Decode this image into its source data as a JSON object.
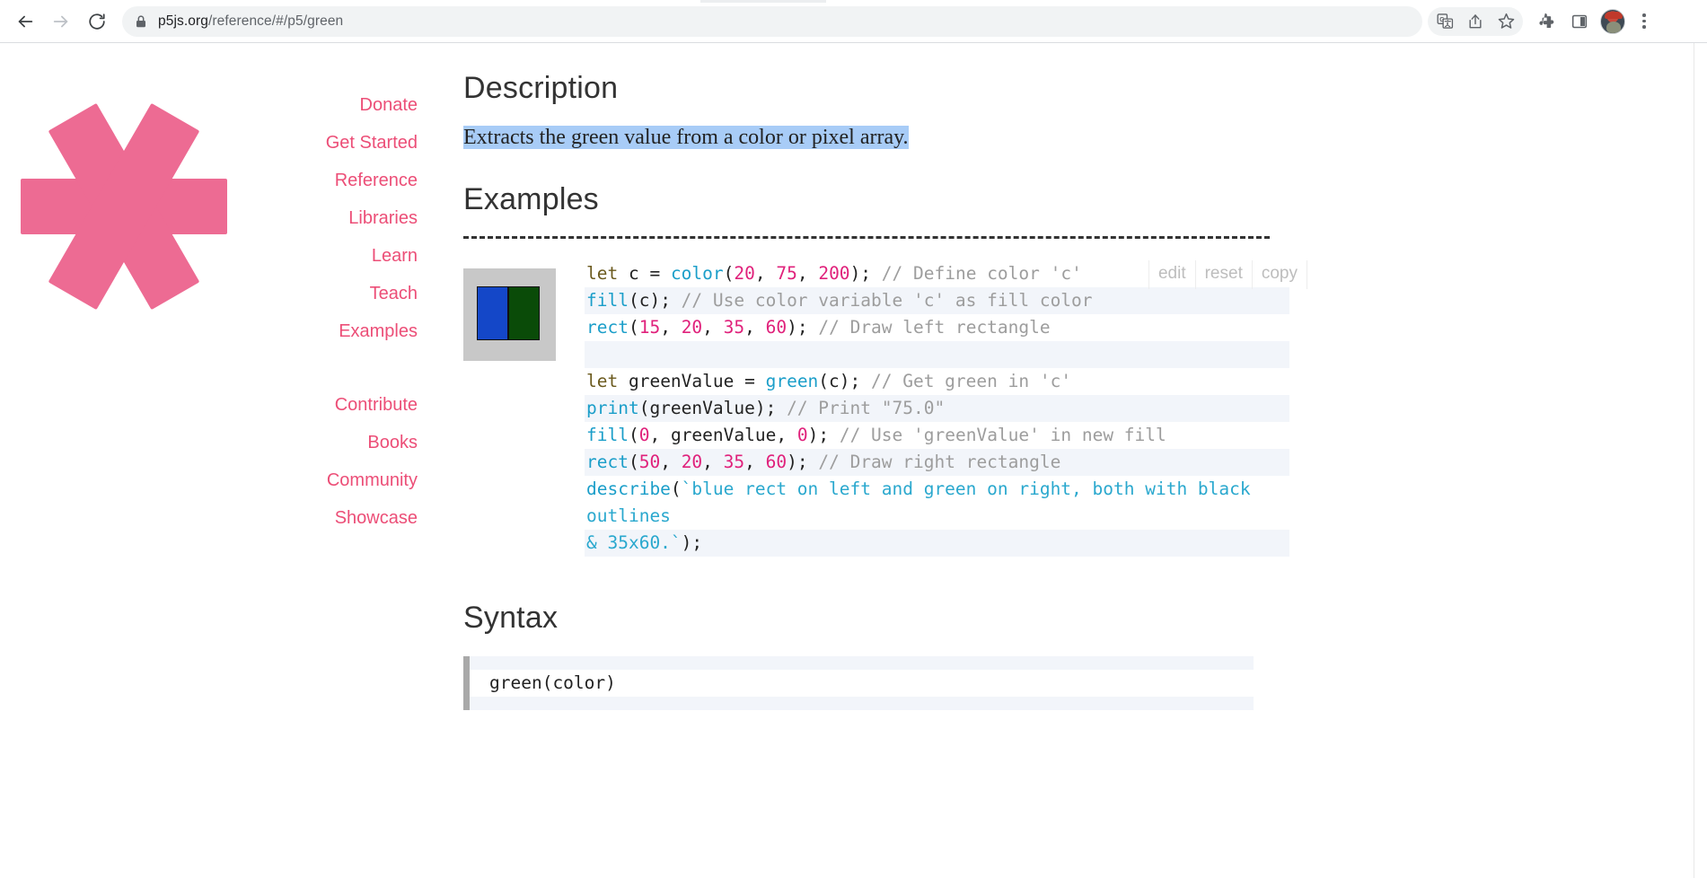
{
  "browser": {
    "back_label": "Back",
    "forward_label": "Forward",
    "reload_label": "Reload",
    "url_secure_part": "p5js.org",
    "url_path_part": "/reference/#/p5/green",
    "url_full": "p5js.org/reference/#/p5/green",
    "actions": [
      {
        "name": "translate-icon",
        "label": "Translate this page"
      },
      {
        "name": "share-icon",
        "label": "Share this page"
      },
      {
        "name": "bookmark-star-icon",
        "label": "Bookmark this tab"
      },
      {
        "name": "extensions-puzzle-icon",
        "label": "Extensions"
      },
      {
        "name": "side-panel-icon",
        "label": "Side panel"
      },
      {
        "name": "profile-avatar",
        "label": "Profile"
      },
      {
        "name": "chrome-menu-kebab-icon",
        "label": "Customize and control Google Chrome"
      }
    ]
  },
  "site": {
    "logo_name": "p5js-asterisk-logo",
    "accent_pink": "#ED6B93",
    "nav_link_color": "#EC4E77",
    "nav_primary": [
      {
        "label": "Donate"
      },
      {
        "label": "Get Started"
      },
      {
        "label": "Reference"
      },
      {
        "label": "Libraries"
      },
      {
        "label": "Learn"
      },
      {
        "label": "Teach"
      },
      {
        "label": "Examples"
      }
    ],
    "nav_secondary": [
      {
        "label": "Contribute"
      },
      {
        "label": "Books"
      },
      {
        "label": "Community"
      },
      {
        "label": "Showcase"
      }
    ]
  },
  "main": {
    "description_heading": "Description",
    "description_text": "Extracts the green value from a color or pixel array.",
    "description_highlight_color": "#A8CCF7",
    "examples_heading": "Examples",
    "syntax_heading": "Syntax",
    "code_toolbar": {
      "edit_label": "edit",
      "reset_label": "reset",
      "copy_label": "copy"
    },
    "canvas_preview": {
      "name": "sketch-canvas-preview",
      "background": "#c8c8c8",
      "left_rect_color": "#1447C8",
      "right_rect_color": "#0A4B08",
      "outline_color": "#111111"
    },
    "code_lines": [
      {
        "alt": false,
        "tokens": [
          {
            "t": "let ",
            "c": "kw"
          },
          {
            "t": "c = ",
            "c": "pl"
          },
          {
            "t": "color",
            "c": "fn"
          },
          {
            "t": "(",
            "c": "pl"
          },
          {
            "t": "20",
            "c": "num"
          },
          {
            "t": ", ",
            "c": "pl"
          },
          {
            "t": "75",
            "c": "num"
          },
          {
            "t": ", ",
            "c": "pl"
          },
          {
            "t": "200",
            "c": "num"
          },
          {
            "t": "); ",
            "c": "pl"
          },
          {
            "t": "// Define color 'c'",
            "c": "com"
          }
        ]
      },
      {
        "alt": true,
        "tokens": [
          {
            "t": "fill",
            "c": "fn"
          },
          {
            "t": "(c); ",
            "c": "pl"
          },
          {
            "t": "// Use color variable 'c' as fill color",
            "c": "com"
          }
        ]
      },
      {
        "alt": false,
        "tokens": [
          {
            "t": "rect",
            "c": "fn"
          },
          {
            "t": "(",
            "c": "pl"
          },
          {
            "t": "15",
            "c": "num"
          },
          {
            "t": ", ",
            "c": "pl"
          },
          {
            "t": "20",
            "c": "num"
          },
          {
            "t": ", ",
            "c": "pl"
          },
          {
            "t": "35",
            "c": "num"
          },
          {
            "t": ", ",
            "c": "pl"
          },
          {
            "t": "60",
            "c": "num"
          },
          {
            "t": "); ",
            "c": "pl"
          },
          {
            "t": "// Draw left rectangle",
            "c": "com"
          }
        ]
      },
      {
        "alt": true,
        "tokens": []
      },
      {
        "alt": false,
        "tokens": [
          {
            "t": "let ",
            "c": "kw"
          },
          {
            "t": "greenValue = ",
            "c": "pl"
          },
          {
            "t": "green",
            "c": "fn"
          },
          {
            "t": "(c); ",
            "c": "pl"
          },
          {
            "t": "// Get green in 'c'",
            "c": "com"
          }
        ]
      },
      {
        "alt": true,
        "tokens": [
          {
            "t": "print",
            "c": "fn"
          },
          {
            "t": "(greenValue); ",
            "c": "pl"
          },
          {
            "t": "// Print \"75.0\"",
            "c": "com"
          }
        ]
      },
      {
        "alt": false,
        "tokens": [
          {
            "t": "fill",
            "c": "fn"
          },
          {
            "t": "(",
            "c": "pl"
          },
          {
            "t": "0",
            "c": "num"
          },
          {
            "t": ", greenValue, ",
            "c": "pl"
          },
          {
            "t": "0",
            "c": "num"
          },
          {
            "t": "); ",
            "c": "pl"
          },
          {
            "t": "// Use 'greenValue' in new fill",
            "c": "com"
          }
        ]
      },
      {
        "alt": true,
        "tokens": [
          {
            "t": "rect",
            "c": "fn"
          },
          {
            "t": "(",
            "c": "pl"
          },
          {
            "t": "50",
            "c": "num"
          },
          {
            "t": ", ",
            "c": "pl"
          },
          {
            "t": "20",
            "c": "num"
          },
          {
            "t": ", ",
            "c": "pl"
          },
          {
            "t": "35",
            "c": "num"
          },
          {
            "t": ", ",
            "c": "pl"
          },
          {
            "t": "60",
            "c": "num"
          },
          {
            "t": "); ",
            "c": "pl"
          },
          {
            "t": "// Draw right rectangle",
            "c": "com"
          }
        ]
      },
      {
        "alt": false,
        "tokens": [
          {
            "t": "describe",
            "c": "fn"
          },
          {
            "t": "(",
            "c": "pl"
          },
          {
            "t": "`blue rect on left and green on right, both with black outlines",
            "c": "str"
          }
        ]
      },
      {
        "alt": true,
        "tokens": [
          {
            "t": "& 35x60.`",
            "c": "str"
          },
          {
            "t": ");",
            "c": "pl"
          }
        ]
      }
    ],
    "syntax_signature": "green(color)"
  }
}
